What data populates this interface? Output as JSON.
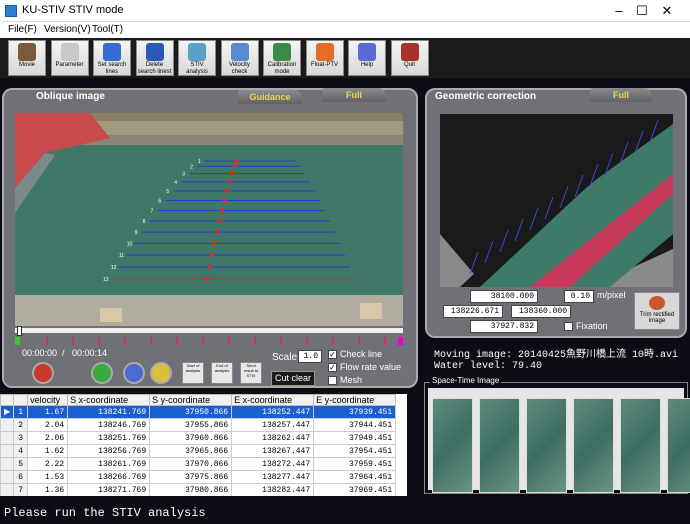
{
  "window": {
    "title": "KU-STIV STIV mode",
    "controls": [
      "–",
      "☐",
      "✕"
    ]
  },
  "menu": [
    "File(F)",
    "Version(V)",
    "Tool(T)"
  ],
  "toolbar": [
    {
      "label": "Movie",
      "icon": "movie-icon",
      "color": "#7a5a3a"
    },
    {
      "label": "Parameter",
      "icon": "parameter-icon",
      "color": "#c8c8c8"
    },
    {
      "label": "Set search lines",
      "icon": "set-search-lines-icon",
      "color": "#3a6ad4"
    },
    {
      "label": "Delete search linest",
      "icon": "delete-search-lines-icon",
      "color": "#2a5ab4"
    },
    {
      "label": "STIV analysis",
      "icon": "stiv-analysis-icon",
      "color": "#5aa0c8"
    },
    {
      "label": "Velocity check",
      "icon": "velocity-check-icon",
      "color": "#5a8ad0"
    },
    {
      "label": "Calibration mode",
      "icon": "calibration-icon",
      "color": "#3a8a4a"
    },
    {
      "label": "Float-PTV",
      "icon": "float-ptv-icon",
      "color": "#e86a2a"
    },
    {
      "label": "Help",
      "icon": "help-icon",
      "color": "#5a6ad4"
    },
    {
      "label": "Quit",
      "icon": "quit-icon",
      "color": "#a8322a"
    }
  ],
  "oblique": {
    "title": "Oblique image",
    "tab_guidance": "Guidance",
    "tab_full": "Full"
  },
  "geometric": {
    "title": "Geometric correction",
    "tab_full": "Full"
  },
  "playback": {
    "time_current": "00:00:00",
    "sep": "/",
    "time_total": "00:00:14"
  },
  "scale": {
    "label": "Scale",
    "value": "1.0"
  },
  "checks": {
    "check_line": "Check line",
    "flow_rate_value": "Flow rate value",
    "mesh": "Mesh",
    "cut_clear": "Cut clear"
  },
  "small_buttons": [
    "Start of analysis",
    "End of analysis",
    "Send result to STIV"
  ],
  "geo_fields": {
    "f1": "38100.000",
    "f2": "0.10",
    "unit": "m/pixel",
    "f3": "138226.671",
    "f4": "138360.000",
    "f5": "37927.832",
    "fixation": "Fixation",
    "trim": "Trim rectified image"
  },
  "info": {
    "moving_image": "Moving image: 20140425魚野川橋上流 10時.avi",
    "water_level": "Water level: 79.40"
  },
  "stimage": {
    "title": "Space-Time Image"
  },
  "table": {
    "headers": [
      "velocity",
      "S x-coordinate",
      "S y-coordinate",
      "E x-coordinate",
      "E y-coordinate"
    ],
    "rows": [
      [
        "1",
        "1.67",
        "138241.769",
        "37950.866",
        "138252.447",
        "37939.451"
      ],
      [
        "2",
        "2.04",
        "138246.769",
        "37955.866",
        "138257.447",
        "37944.451"
      ],
      [
        "3",
        "2.06",
        "138251.769",
        "37960.866",
        "138262.447",
        "37949.451"
      ],
      [
        "4",
        "1.62",
        "138256.769",
        "37965.866",
        "138267.447",
        "37954.451"
      ],
      [
        "5",
        "2.22",
        "138261.769",
        "37970.866",
        "138272.447",
        "37959.451"
      ],
      [
        "6",
        "1.53",
        "138266.769",
        "37975.866",
        "138277.447",
        "37964.451"
      ],
      [
        "7",
        "1.36",
        "138271.769",
        "37980.866",
        "138282.447",
        "37969.451"
      ]
    ]
  },
  "status": "Please run the STIV analysis",
  "overlay_labels": [
    "1",
    "2",
    "3",
    "4",
    "5",
    "6",
    "7",
    "8",
    "9",
    "10",
    "11",
    "12",
    "13"
  ]
}
